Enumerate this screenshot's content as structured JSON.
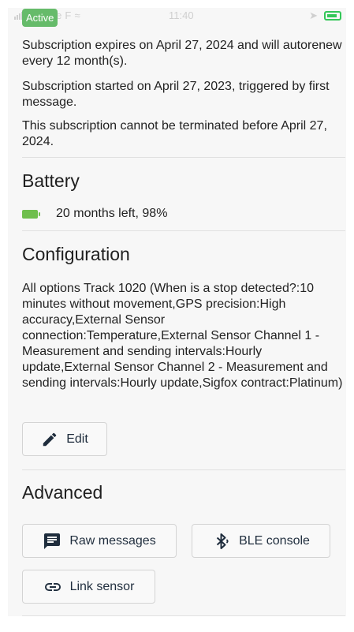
{
  "status_bar": {
    "carrier": "Orange F",
    "time": "11:40",
    "battery_color": "#34c759"
  },
  "subscription": {
    "badge": "Active",
    "expires": "Subscription expires on April 27, 2024 and will autorenew every 12 month(s).",
    "started": "Subscription started on April 27, 2023, triggered by first message.",
    "termination": "This subscription cannot be terminated before April 27, 2024."
  },
  "battery": {
    "title": "Battery",
    "icon": "battery-icon",
    "status": "20 months left, 98%",
    "level_percent": 98,
    "color": "#6fbf4d"
  },
  "configuration": {
    "title": "Configuration",
    "description": "All options Track 1020 (When is a stop detected?:10 minutes without movement,GPS precision:High accuracy,External Sensor connection:Temperature,External Sensor Channel 1 - Measurement and sending intervals:Hourly update,External Sensor Channel 2 - Measurement and sending intervals:Hourly update,Sigfox contract:Platinum)",
    "edit_label": "Edit",
    "edit_icon": "pencil-icon"
  },
  "advanced": {
    "title": "Advanced",
    "raw_messages_label": "Raw messages",
    "raw_messages_icon": "message-icon",
    "ble_console_label": "BLE console",
    "ble_console_icon": "bluetooth-icon",
    "link_sensor_label": "Link sensor",
    "link_sensor_icon": "link-icon"
  },
  "colors": {
    "badge": "#66bb6a",
    "icon_dark": "#1f2d3d"
  }
}
